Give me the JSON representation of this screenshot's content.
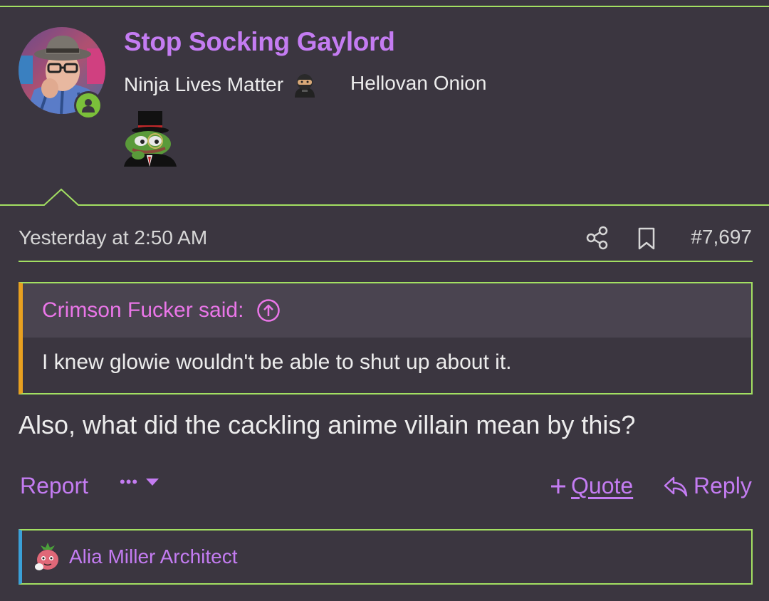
{
  "user": {
    "name": "Stop Socking Gaylord",
    "title": "Ninja Lives Matter",
    "title_icon": "ninja-icon",
    "banner": "Hellovan Onion",
    "avatar": "avatar-photo",
    "status": "online",
    "badge_image": "pepe-top-hat-icon"
  },
  "post": {
    "date": "Yesterday at 2:50 AM",
    "number": "#7,697",
    "quote": {
      "author_line": "Crimson Fucker said:",
      "text": "I knew glowie wouldn't be able to shut up about it."
    },
    "body": "Also, what did the cackling anime villain mean by this?"
  },
  "actions": {
    "report": "Report",
    "more": "•••",
    "quote": "Quote",
    "reply": "Reply"
  },
  "reactions": {
    "names": "Alia Miller Architect",
    "icon": "strawberry-reaction-icon"
  },
  "colors": {
    "background": "#3b3640",
    "accent_green": "#a3e062",
    "username_purple": "#c47cf2",
    "quote_pink": "#ea76e8",
    "quote_orange": "#e8a020",
    "reaction_blue": "#3aa0d8",
    "online_green": "#7bc03a"
  }
}
